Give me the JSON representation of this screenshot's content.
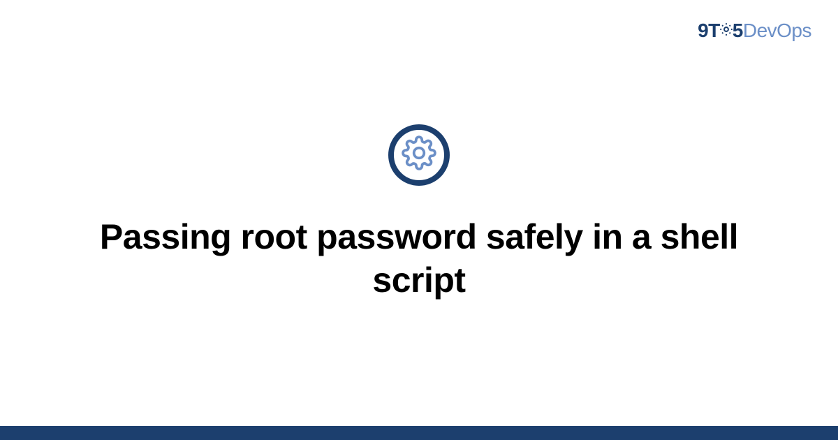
{
  "logo": {
    "part1": "9T",
    "part2": "5",
    "part3": "DevOps"
  },
  "main": {
    "title": "Passing root password safely in a shell script"
  },
  "colors": {
    "primary": "#1c3f6e",
    "accent": "#6b8fc7"
  }
}
